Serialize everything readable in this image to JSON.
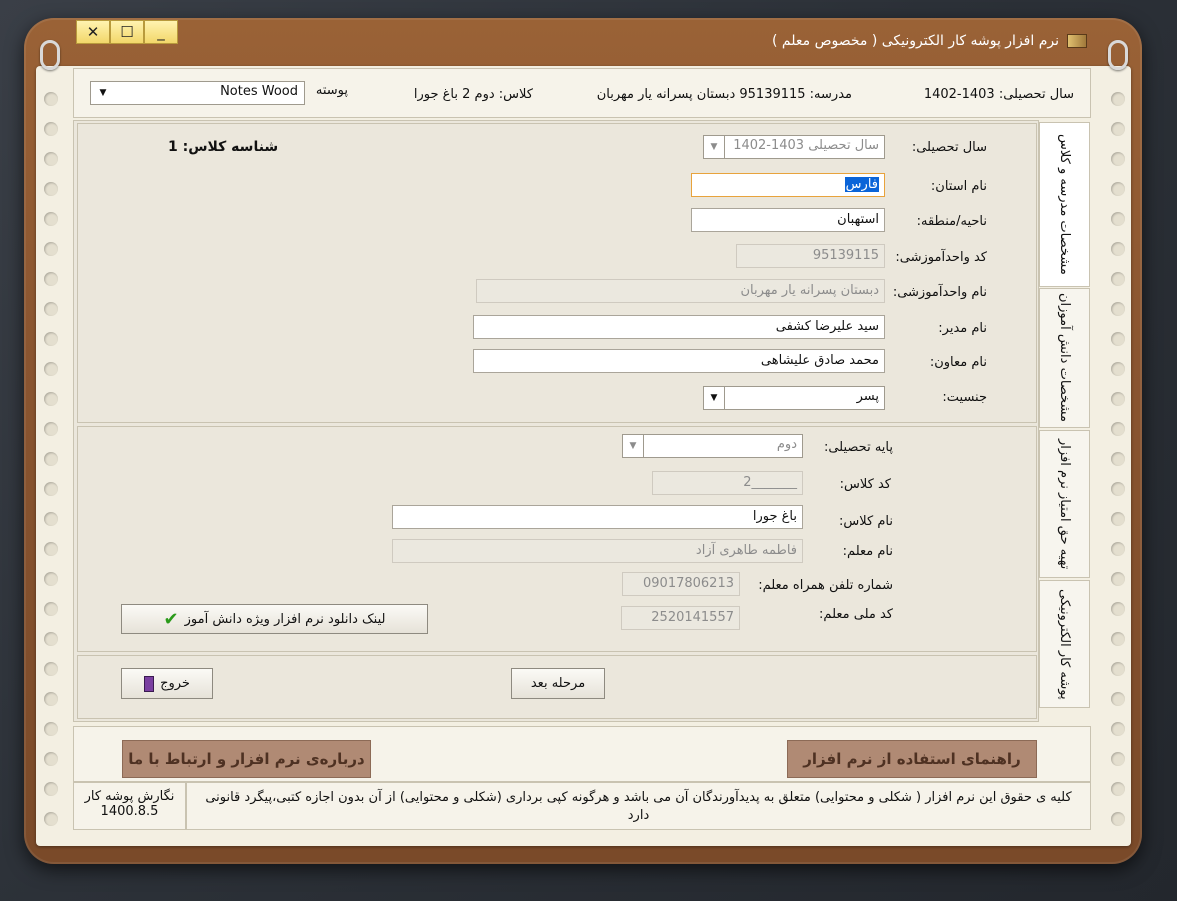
{
  "window": {
    "title": "نرم افزار پوشه کار الکترونیکی ( مخصوص معلم )",
    "close_glyph": "✕",
    "maximize_glyph": "☐",
    "minimize_glyph": "_"
  },
  "header": {
    "year": "سال تحصیلی: 1403-1402",
    "school": "مدرسه: 95139115 دبستان پسرانه یار مهربان",
    "class": "کلاس: دوم 2 باغ جورا",
    "skin_label": "پوسته",
    "skin_value": "Notes Wood"
  },
  "tabs": [
    {
      "label": "مشخصات مدرسه و کلاس"
    },
    {
      "label": "مشخصات دانش آموزان"
    },
    {
      "label": "تهیه حق امتیاز نرم افزار"
    },
    {
      "label": "پوشه کار الکترونیکی"
    }
  ],
  "school_form": {
    "class_id_label": "شناسه کلاس: 1",
    "year_label": "سال تحصیلی:",
    "year_value": "سال تحصیلی 1403-1402",
    "province_label": "نام استان:",
    "province_value": "فارس",
    "region_label": "ناحیه/منطقه:",
    "region_value": "استهبان",
    "unit_code_label": "کد واحدآموزشی:",
    "unit_code_value": "95139115",
    "unit_name_label": "نام واحدآموزشی:",
    "unit_name_value": "دبستان پسرانه یار مهربان",
    "principal_label": "نام مدیر:",
    "principal_value": "سید علیرضا کشفی",
    "deputy_label": "نام معاون:",
    "deputy_value": "محمد صادق علیشاهی",
    "gender_label": "جنسیت:",
    "gender_value": "پسر"
  },
  "class_form": {
    "grade_label": "پایه تحصیلی:",
    "grade_value": "دوم",
    "class_code_label": "کد کلاس:",
    "class_code_value": "_______2",
    "class_name_label": "نام کلاس:",
    "class_name_value": "باغ جورا",
    "teacher_label": "نام معلم:",
    "teacher_value": "فاطمه طاهری آزاد",
    "mobile_label": "شماره تلفن همراه معلم:",
    "mobile_value": "09017806213",
    "national_id_label": "کد ملی معلم:",
    "national_id_value": "2520141557",
    "download_link_label": "لینک دانلود نرم افزار ویژه دانش آموز"
  },
  "actions": {
    "exit_label": "خروج",
    "next_label": "مرحله بعد"
  },
  "bottom": {
    "about_label": "درباره‌ی نرم افزار و ارتباط با ما",
    "guide_label": "راهنمای استفاده از نرم افزار",
    "version_line1": "نگارش پوشه کار",
    "version_line2": "1400.8.5",
    "copyright": "کلیه ی حقوق این نرم افزار ( شکلی و محتوایی) متعلق به پدیدآورندگان آن می باشد و هرگونه کپی برداری (شکلی و محتوایی) از آن بدون اجازه کتبی،پیگرد قانونی دارد"
  },
  "colors": {
    "accent_selection": "#0a64d8",
    "wood": "#8a5530",
    "big_button": "#b08a74"
  }
}
